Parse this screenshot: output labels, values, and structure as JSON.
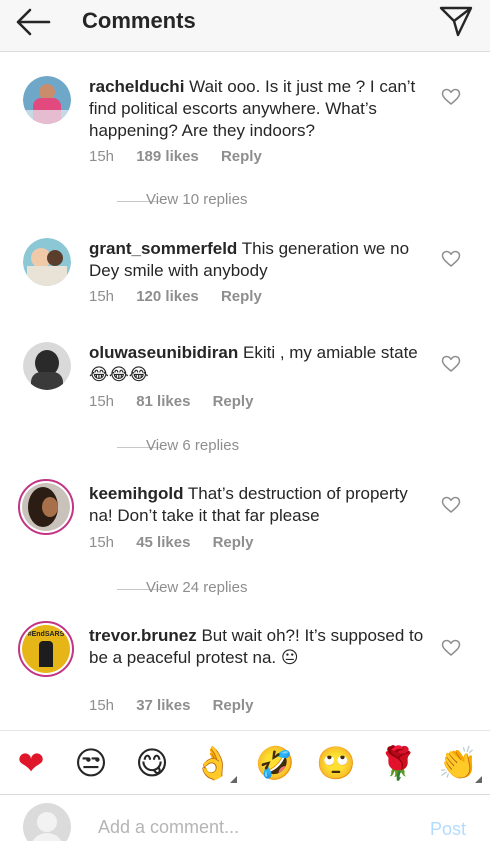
{
  "header": {
    "title": "Comments",
    "back_icon": "arrow-left-icon",
    "send_icon": "paper-plane-icon"
  },
  "comments": [
    {
      "username": "rachelduchi",
      "text": "Wait ooo. Is it just me ? I can’t find political escorts anywhere. What’s happening? Are they indoors?",
      "time": "15h",
      "likes": "189 likes",
      "reply": "Reply",
      "view_replies": "View 10 replies"
    },
    {
      "username": "grant_sommerfeld",
      "text": "This generation we no Dey smile with anybody",
      "time": "15h",
      "likes": "120 likes",
      "reply": "Reply",
      "view_replies": ""
    },
    {
      "username": "oluwaseunibidiran",
      "text": "Ekiti , my amiable state😂😂😂",
      "time": "15h",
      "likes": "81 likes",
      "reply": "Reply",
      "view_replies": "View 6 replies"
    },
    {
      "username": "keemihgold",
      "text": "That’s destruction of property na! Don’t take it that far please",
      "time": "15h",
      "likes": "45 likes",
      "reply": "Reply",
      "view_replies": "View 24 replies"
    },
    {
      "username": "trevor.brunez",
      "text": "But wait oh?! It’s supposed to be a peaceful protest na. 😐",
      "time": "15h",
      "likes": "37 likes",
      "reply": "Reply",
      "view_replies": "",
      "avatar_text": "#EndSARS"
    }
  ],
  "emoji_bar": [
    "❤",
    "😒",
    "😋",
    "👌",
    "🤣",
    "🙄",
    "🌹",
    "👏"
  ],
  "composer": {
    "placeholder": "Add a comment...",
    "post_label": "Post"
  },
  "colors": {
    "header_bg": "#f7f7f7",
    "text": "#262626",
    "muted": "#8e8e8e",
    "post_disabled": "#b3dbff",
    "story_ring": "#c13584"
  }
}
